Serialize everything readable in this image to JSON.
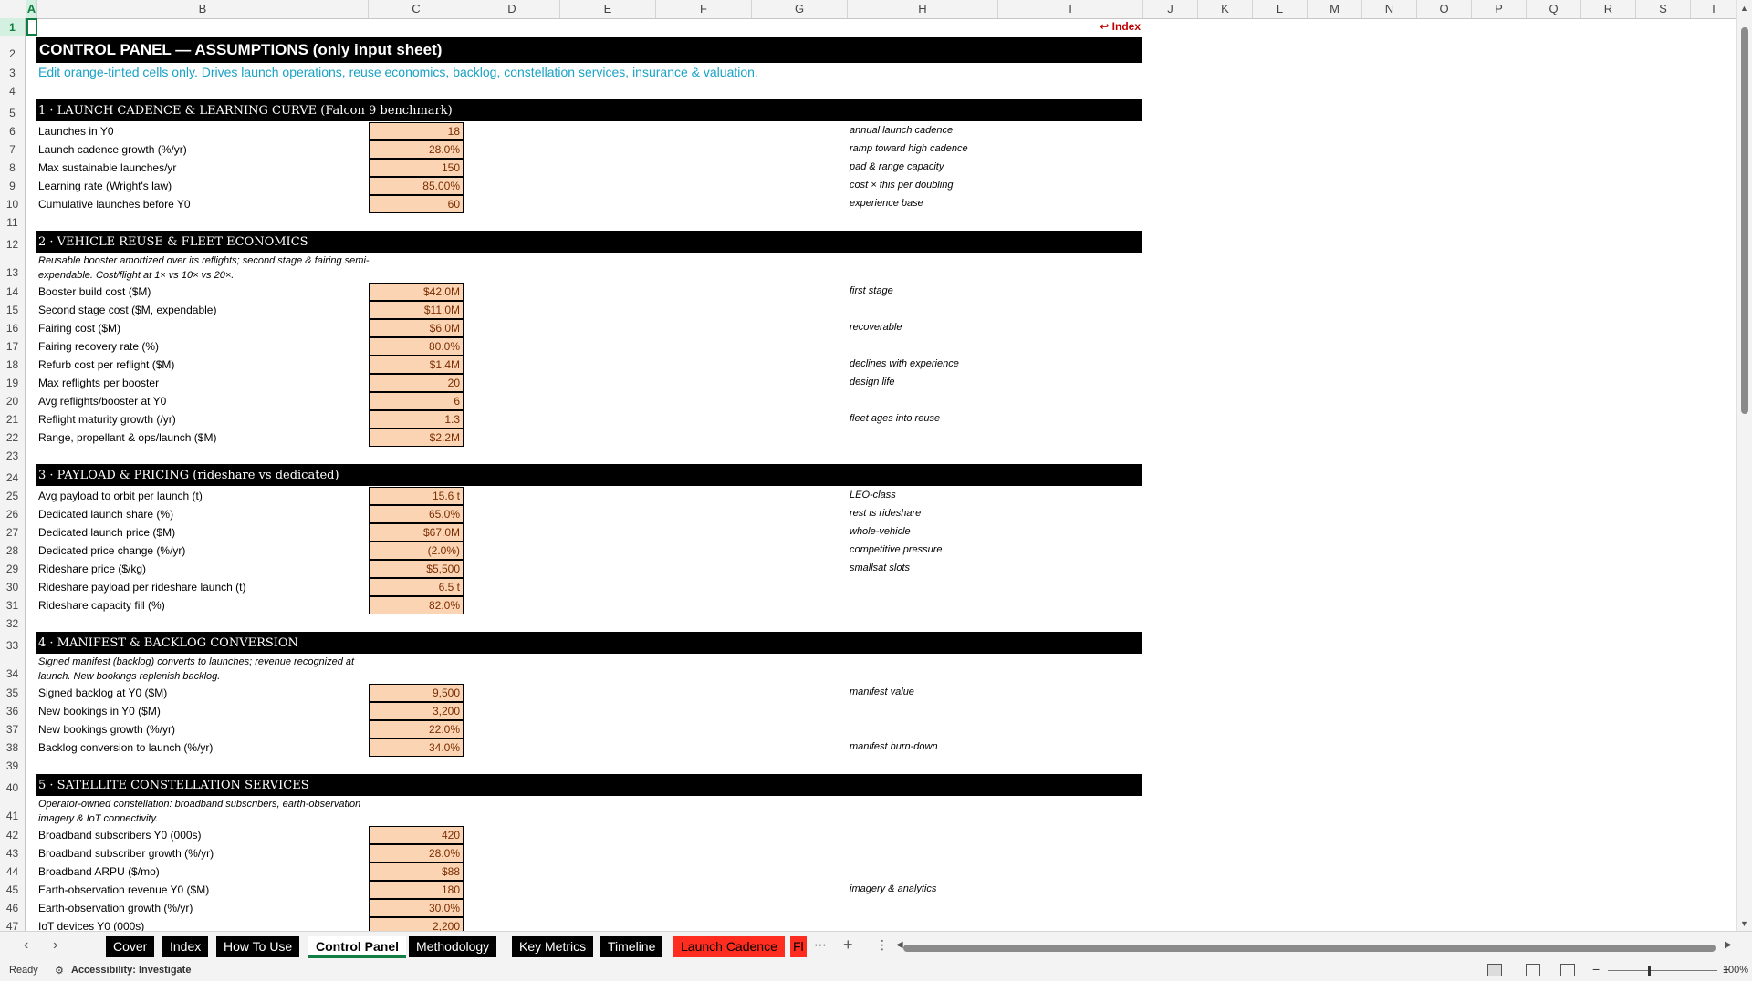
{
  "columns": [
    "A",
    "B",
    "C",
    "D",
    "E",
    "F",
    "G",
    "H",
    "I",
    "J",
    "K",
    "L",
    "M",
    "N",
    "O",
    "P",
    "Q",
    "R",
    "S",
    "T"
  ],
  "rows": [
    "1",
    "2",
    "3",
    "4",
    "5",
    "6",
    "7",
    "8",
    "9",
    "10",
    "11",
    "12",
    "13",
    "14",
    "15",
    "16",
    "17",
    "18",
    "19",
    "20",
    "21",
    "22",
    "23",
    "24",
    "25",
    "26",
    "27",
    "28",
    "29",
    "30",
    "31",
    "32",
    "33",
    "34",
    "35",
    "36",
    "37",
    "38",
    "39",
    "40",
    "41",
    "42",
    "43",
    "44",
    "45",
    "46",
    "47"
  ],
  "index_link": "↩ Index",
  "title": "CONTROL PANEL — ASSUMPTIONS (only input sheet)",
  "subtitle": "Edit orange-tinted cells only. Drives launch operations, reuse economics, backlog, constellation services, insurance & valuation.",
  "sections": {
    "s1": "1 · LAUNCH CADENCE & LEARNING CURVE (Falcon 9 benchmark)",
    "s2": "2 · VEHICLE REUSE & FLEET ECONOMICS",
    "s3": "3 · PAYLOAD & PRICING (rideshare vs dedicated)",
    "s4": "4 · MANIFEST & BACKLOG CONVERSION",
    "s5": "5 · SATELLITE CONSTELLATION SERVICES"
  },
  "notes": {
    "n13": "Reusable booster amortized over its reflights; second stage & fairing semi-expendable. Cost/flight at 1× vs 10× vs 20×.",
    "n34": "Signed manifest (backlog) converts to launches; revenue recognized at launch. New bookings replenish backlog.",
    "n41": "Operator-owned constellation: broadband subscribers, earth-observation imagery & IoT connectivity."
  },
  "inputs": {
    "r6": {
      "label": "Launches in Y0",
      "value": "18",
      "comment": "annual launch cadence"
    },
    "r7": {
      "label": "Launch cadence growth (%/yr)",
      "value": "28.0%",
      "comment": "ramp toward high cadence"
    },
    "r8": {
      "label": "Max sustainable launches/yr",
      "value": "150",
      "comment": "pad & range capacity"
    },
    "r9": {
      "label": "Learning rate (Wright's law)",
      "value": "85.00%",
      "comment": "cost × this per doubling"
    },
    "r10": {
      "label": "Cumulative launches before Y0",
      "value": "60",
      "comment": "experience base"
    },
    "r14": {
      "label": "Booster build cost ($M)",
      "value": "$42.0M",
      "comment": "first stage"
    },
    "r15": {
      "label": "Second stage cost ($M, expendable)",
      "value": "$11.0M",
      "comment": ""
    },
    "r16": {
      "label": "Fairing cost ($M)",
      "value": "$6.0M",
      "comment": "recoverable"
    },
    "r17": {
      "label": "Fairing recovery rate (%)",
      "value": "80.0%",
      "comment": ""
    },
    "r18": {
      "label": "Refurb cost per reflight ($M)",
      "value": "$1.4M",
      "comment": "declines with experience"
    },
    "r19": {
      "label": "Max reflights per booster",
      "value": "20",
      "comment": "design life"
    },
    "r20": {
      "label": "Avg reflights/booster at Y0",
      "value": "6",
      "comment": ""
    },
    "r21": {
      "label": "Reflight maturity growth (/yr)",
      "value": "1.3",
      "comment": "fleet ages into reuse"
    },
    "r22": {
      "label": "Range, propellant & ops/launch ($M)",
      "value": "$2.2M",
      "comment": ""
    },
    "r25": {
      "label": "Avg payload to orbit per launch (t)",
      "value": "15.6 t",
      "comment": "LEO-class"
    },
    "r26": {
      "label": "Dedicated launch share (%)",
      "value": "65.0%",
      "comment": "rest is rideshare"
    },
    "r27": {
      "label": "Dedicated launch price ($M)",
      "value": "$67.0M",
      "comment": "whole-vehicle"
    },
    "r28": {
      "label": "Dedicated price change (%/yr)",
      "value": "(2.0%)",
      "comment": "competitive pressure"
    },
    "r29": {
      "label": "Rideshare price ($/kg)",
      "value": "$5,500",
      "comment": "smallsat slots"
    },
    "r30": {
      "label": "Rideshare payload per rideshare launch (t)",
      "value": "6.5 t",
      "comment": ""
    },
    "r31": {
      "label": "Rideshare capacity fill (%)",
      "value": "82.0%",
      "comment": ""
    },
    "r35": {
      "label": "Signed backlog at Y0 ($M)",
      "value": "9,500",
      "comment": "manifest value"
    },
    "r36": {
      "label": "New bookings in Y0 ($M)",
      "value": "3,200",
      "comment": ""
    },
    "r37": {
      "label": "New bookings growth (%/yr)",
      "value": "22.0%",
      "comment": ""
    },
    "r38": {
      "label": "Backlog conversion to launch (%/yr)",
      "value": "34.0%",
      "comment": "manifest burn-down"
    },
    "r42": {
      "label": "Broadband subscribers Y0 (000s)",
      "value": "420",
      "comment": ""
    },
    "r43": {
      "label": "Broadband subscriber growth (%/yr)",
      "value": "28.0%",
      "comment": ""
    },
    "r44": {
      "label": "Broadband ARPU ($/mo)",
      "value": "$88",
      "comment": ""
    },
    "r45": {
      "label": "Earth-observation revenue Y0 ($M)",
      "value": "180",
      "comment": "imagery & analytics"
    },
    "r46": {
      "label": "Earth-observation growth (%/yr)",
      "value": "30.0%",
      "comment": ""
    },
    "r47": {
      "label": "IoT devices Y0 (000s)",
      "value": "2,200",
      "comment": ""
    }
  },
  "tabs": [
    "Cover",
    "Index",
    "How To Use",
    "Control Panel",
    "Methodology",
    "Key Metrics",
    "Timeline",
    "Launch Cadence",
    "Fl"
  ],
  "active_tab": "Control Panel",
  "status": {
    "ready": "Ready",
    "accessibility": "Accessibility: Investigate",
    "zoom": "100%"
  },
  "icons": {
    "prev": "chevron-left-icon",
    "next": "chevron-right-icon",
    "more": "ellipsis-icon",
    "add": "plus-icon"
  }
}
